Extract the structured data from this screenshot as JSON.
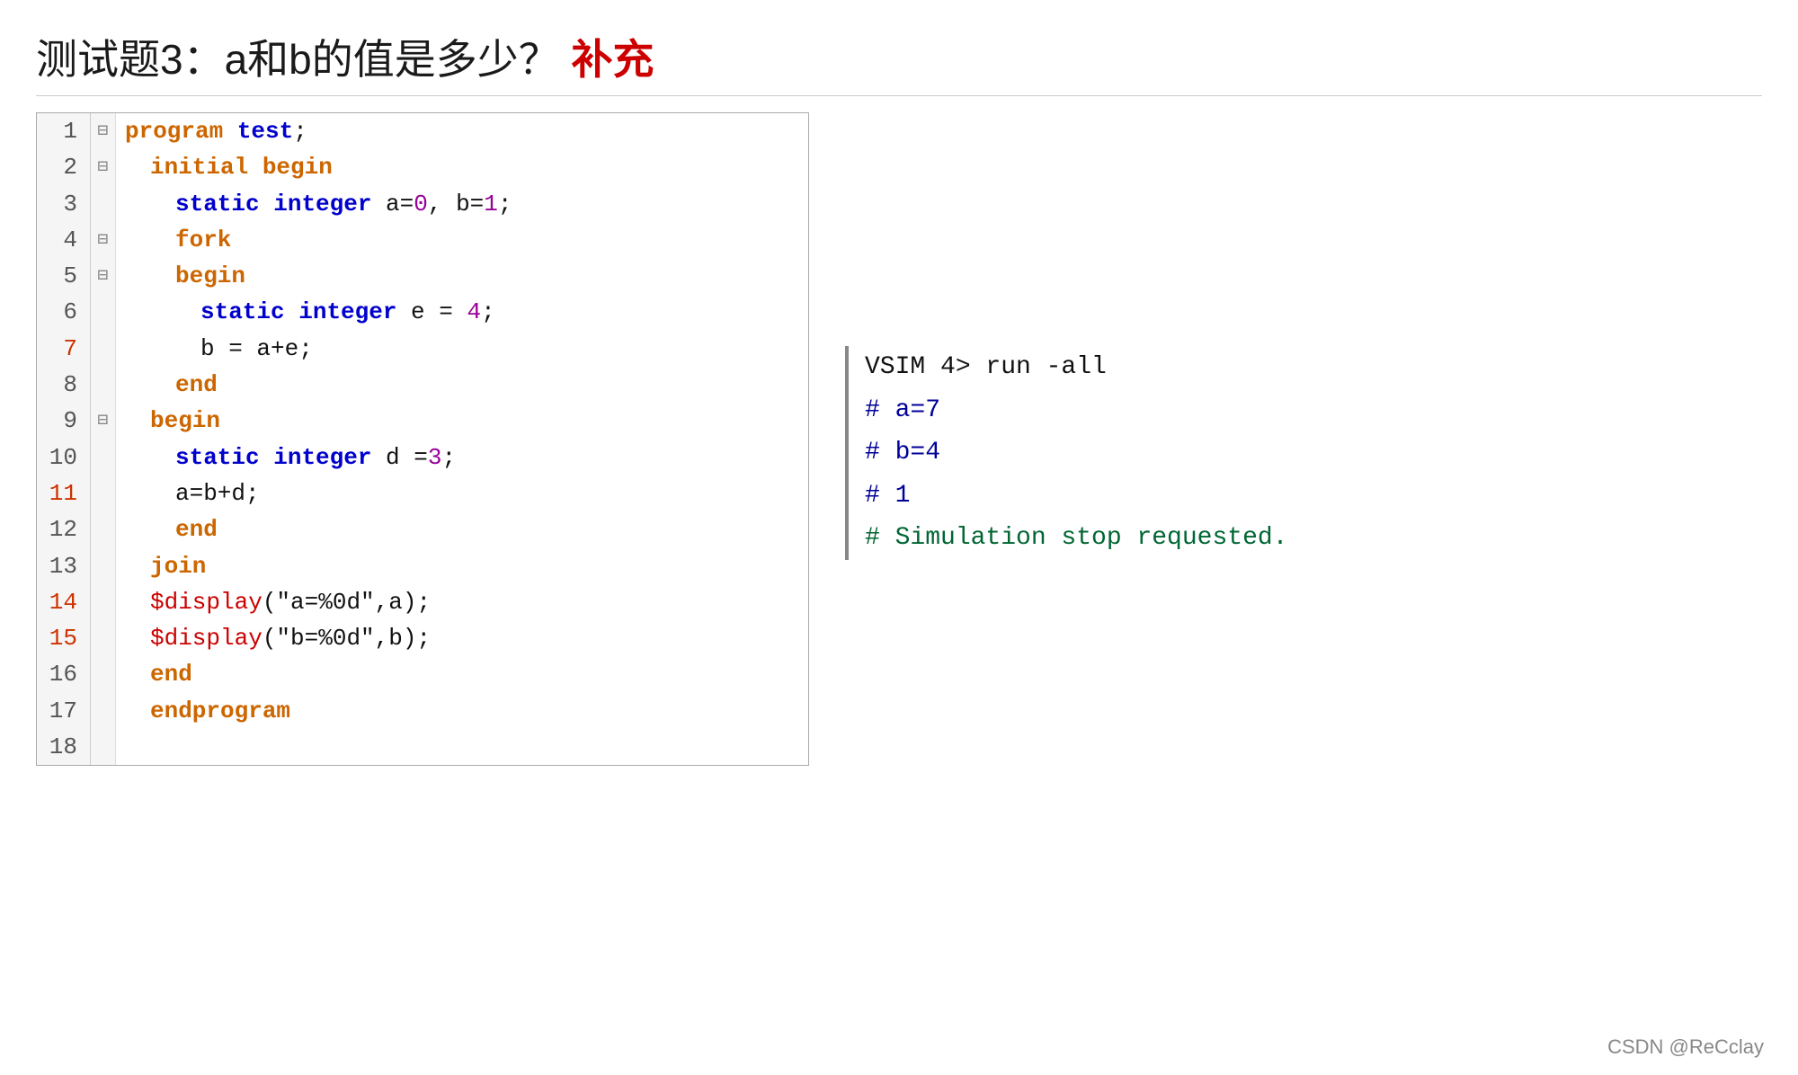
{
  "title": {
    "main": "测试题3：a和b的值是多少？",
    "highlight": "补充"
  },
  "code": {
    "lines": [
      {
        "num": "1",
        "numHighlight": false,
        "fold": "⊟",
        "indent": 0,
        "tokens": [
          {
            "t": "kw-orange",
            "v": "program"
          },
          {
            "t": "plain",
            "v": " "
          },
          {
            "t": "kw-blue",
            "v": "test"
          },
          {
            "t": "plain",
            "v": ";"
          }
        ]
      },
      {
        "num": "2",
        "numHighlight": false,
        "fold": "⊟",
        "indent": 1,
        "tokens": [
          {
            "t": "kw-orange",
            "v": "initial"
          },
          {
            "t": "plain",
            "v": " "
          },
          {
            "t": "kw-orange",
            "v": "begin"
          }
        ]
      },
      {
        "num": "3",
        "numHighlight": false,
        "fold": "",
        "indent": 2,
        "tokens": [
          {
            "t": "kw-blue",
            "v": "static"
          },
          {
            "t": "plain",
            "v": " "
          },
          {
            "t": "kw-blue",
            "v": "integer"
          },
          {
            "t": "plain",
            "v": " a="
          },
          {
            "t": "val-purple",
            "v": "0"
          },
          {
            "t": "plain",
            "v": ", b="
          },
          {
            "t": "val-purple",
            "v": "1"
          },
          {
            "t": "plain",
            "v": ";"
          }
        ]
      },
      {
        "num": "4",
        "numHighlight": false,
        "fold": "⊟",
        "indent": 2,
        "tokens": [
          {
            "t": "kw-orange",
            "v": "fork"
          }
        ]
      },
      {
        "num": "5",
        "numHighlight": false,
        "fold": "⊟",
        "indent": 2,
        "tokens": [
          {
            "t": "kw-orange",
            "v": "begin"
          }
        ]
      },
      {
        "num": "6",
        "numHighlight": false,
        "fold": "",
        "indent": 3,
        "tokens": [
          {
            "t": "kw-blue",
            "v": "static"
          },
          {
            "t": "plain",
            "v": " "
          },
          {
            "t": "kw-blue",
            "v": "integer"
          },
          {
            "t": "plain",
            "v": " e = "
          },
          {
            "t": "val-purple",
            "v": "4"
          },
          {
            "t": "plain",
            "v": ";"
          }
        ]
      },
      {
        "num": "7",
        "numHighlight": true,
        "fold": "",
        "indent": 3,
        "tokens": [
          {
            "t": "plain",
            "v": "b = a+e;"
          }
        ]
      },
      {
        "num": "8",
        "numHighlight": false,
        "fold": "",
        "indent": 2,
        "tokens": [
          {
            "t": "kw-orange",
            "v": "end"
          }
        ]
      },
      {
        "num": "9",
        "numHighlight": false,
        "fold": "⊟",
        "indent": 1,
        "tokens": [
          {
            "t": "kw-orange",
            "v": "begin"
          }
        ]
      },
      {
        "num": "10",
        "numHighlight": false,
        "fold": "",
        "indent": 2,
        "tokens": [
          {
            "t": "kw-blue",
            "v": "static"
          },
          {
            "t": "plain",
            "v": " "
          },
          {
            "t": "kw-blue",
            "v": "integer"
          },
          {
            "t": "plain",
            "v": " d ="
          },
          {
            "t": "val-purple",
            "v": "3"
          },
          {
            "t": "plain",
            "v": ";"
          }
        ]
      },
      {
        "num": "11",
        "numHighlight": true,
        "fold": "",
        "indent": 2,
        "tokens": [
          {
            "t": "plain",
            "v": "a=b+d;"
          }
        ]
      },
      {
        "num": "12",
        "numHighlight": false,
        "fold": "",
        "indent": 2,
        "tokens": [
          {
            "t": "kw-orange",
            "v": "end"
          }
        ]
      },
      {
        "num": "13",
        "numHighlight": false,
        "fold": "",
        "indent": 1,
        "tokens": [
          {
            "t": "kw-orange",
            "v": "join"
          }
        ]
      },
      {
        "num": "14",
        "numHighlight": true,
        "fold": "",
        "indent": 1,
        "tokens": [
          {
            "t": "sys-red",
            "v": "$display"
          },
          {
            "t": "plain",
            "v": "(\"a=%0d\",a);"
          }
        ]
      },
      {
        "num": "15",
        "numHighlight": true,
        "fold": "",
        "indent": 1,
        "tokens": [
          {
            "t": "sys-red",
            "v": "$display"
          },
          {
            "t": "plain",
            "v": "(\"b=%0d\",b);"
          }
        ]
      },
      {
        "num": "16",
        "numHighlight": false,
        "fold": "",
        "indent": 1,
        "tokens": [
          {
            "t": "kw-orange",
            "v": "end"
          }
        ]
      },
      {
        "num": "17",
        "numHighlight": false,
        "fold": "",
        "indent": 1,
        "tokens": [
          {
            "t": "kw-orange",
            "v": "endprogram"
          }
        ]
      },
      {
        "num": "18",
        "numHighlight": false,
        "fold": "",
        "indent": 0,
        "tokens": []
      }
    ]
  },
  "terminal": {
    "lines": [
      {
        "type": "prompt",
        "text": "VSIM 4> run -all"
      },
      {
        "type": "hash",
        "text": "#  a=7"
      },
      {
        "type": "hash",
        "text": "#  b=4"
      },
      {
        "type": "hash",
        "text": "#  1"
      },
      {
        "type": "sim",
        "text": "#  Simulation stop requested."
      }
    ]
  },
  "watermark": "CSDN @ReCclay"
}
